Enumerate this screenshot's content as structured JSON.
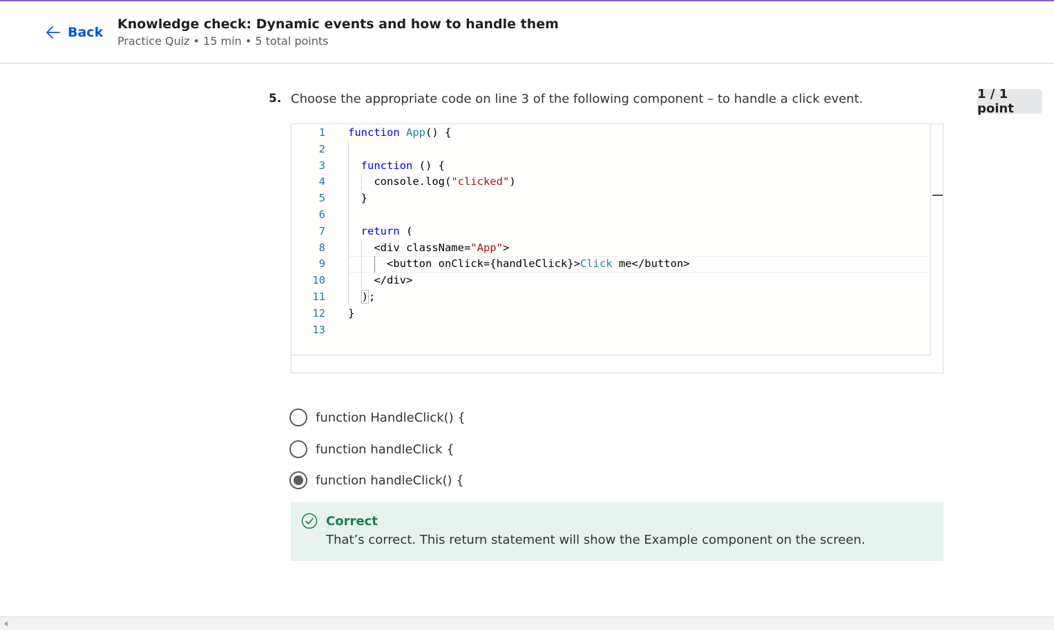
{
  "header": {
    "back_label": "Back",
    "title": "Knowledge check: Dynamic events and how to handle them",
    "meta": "Practice Quiz • 15 min • 5 total points"
  },
  "question": {
    "number": "5.",
    "text": "Choose the appropriate code on line 3 of the following component – to handle a click event.",
    "score": "1 / 1 point"
  },
  "code": {
    "line_numbers": [
      "1",
      "2",
      "3",
      "4",
      "5",
      "6",
      "7",
      "8",
      "9",
      "10",
      "11",
      "12",
      "13"
    ],
    "lines": [
      "function App() {",
      "",
      "  function () {",
      "    console.log(\"clicked\")",
      "  }",
      "",
      "  return (",
      "    <div className=\"App\">",
      "      <button onClick={handleClick}>Click me</button>",
      "    </div>",
      "  );",
      "}",
      ""
    ]
  },
  "options": [
    {
      "label": "function HandleClick() {",
      "selected": false
    },
    {
      "label": "function handleClick {",
      "selected": false
    },
    {
      "label": "function handleClick() {",
      "selected": true
    }
  ],
  "feedback": {
    "title": "Correct",
    "text": "That’s correct. This return statement will show the Example component on the screen.",
    "color": "#1d7c50"
  },
  "colors": {
    "accent": "#0056d2",
    "top_bar": "#8a5ac8",
    "feedback_bg": "#e7f2ee"
  }
}
